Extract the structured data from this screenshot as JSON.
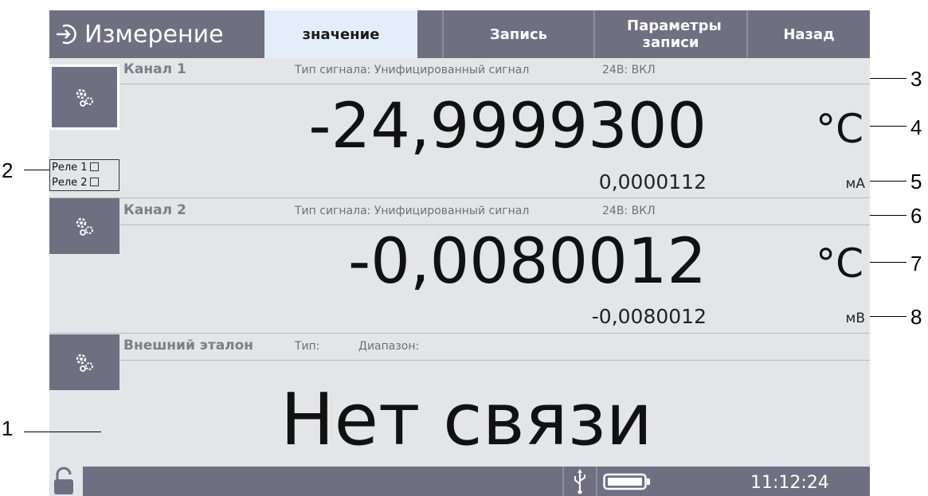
{
  "header": {
    "title": "Измерение",
    "tabs": [
      {
        "label": "значение",
        "active": true
      },
      {
        "label": "Запись",
        "active": false
      },
      {
        "label": "Параметры записи",
        "active": false
      },
      {
        "label": "Назад",
        "active": false
      }
    ]
  },
  "channel1": {
    "name": "Канал 1",
    "signal_type": "Тип сигнала: Унифицированный сигнал",
    "supply": "24В: ВКЛ",
    "value": "-24,9999300",
    "unit": "°C",
    "raw_value": "0,0000112",
    "raw_unit": "мА"
  },
  "relays": {
    "relay1": "Реле 1",
    "relay2": "Реле 2"
  },
  "channel2": {
    "name": "Канал 2",
    "signal_type": "Тип сигнала: Унифицированный сигнал",
    "supply": "24В: ВКЛ",
    "value": "-0,0080012",
    "unit": "°C",
    "raw_value": "-0,0080012",
    "raw_unit": "мВ"
  },
  "external": {
    "name": "Внешний эталон",
    "type_label": "Тип:",
    "range_label": "Диапазон:",
    "status": "Нет связи"
  },
  "statusbar": {
    "time": "11:12:24"
  },
  "callouts": [
    "1",
    "2",
    "3",
    "4",
    "5",
    "6",
    "7",
    "8"
  ],
  "colors": {
    "bar": "#6e7082",
    "panel": "#e3e5e8",
    "active_tab": "#e3eef8"
  },
  "icons": [
    "login-icon",
    "gear-icon",
    "unlock-icon",
    "usb-icon",
    "battery-icon"
  ]
}
